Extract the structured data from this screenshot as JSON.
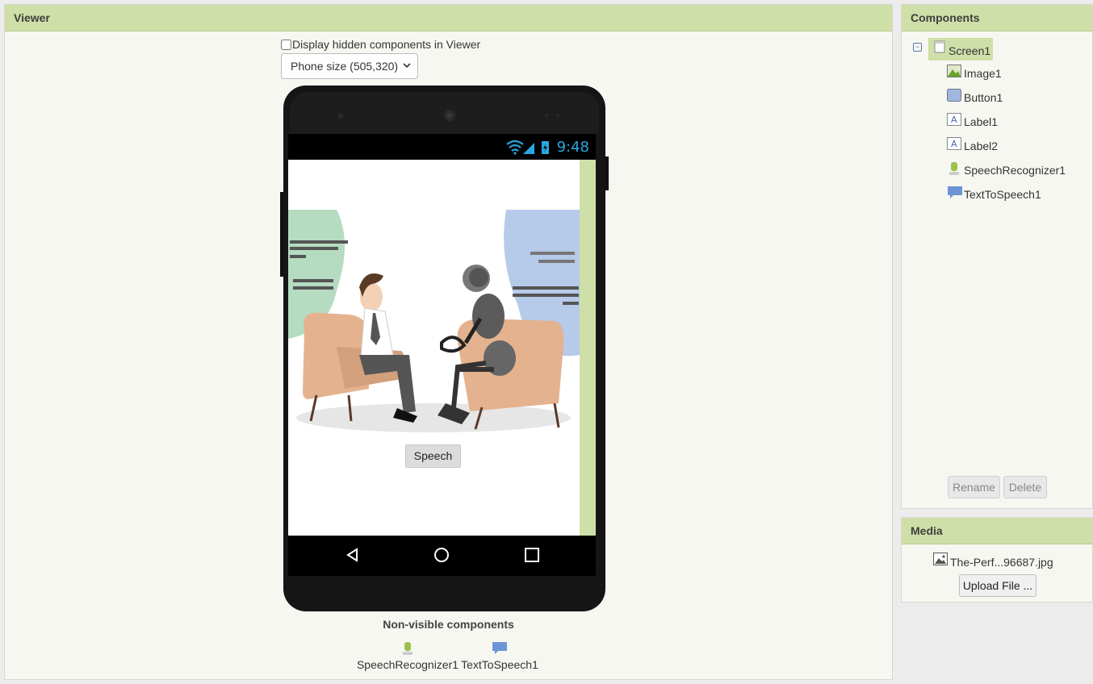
{
  "viewer": {
    "title": "Viewer",
    "hidden_label": "Display hidden components in Viewer",
    "size_select": "Phone size (505,320)",
    "phone": {
      "time": "9:48",
      "button_label": "Speech"
    },
    "nonvisible_title": "Non-visible components",
    "nonvisible": [
      {
        "label": "SpeechRecognizer1",
        "icon": "microphone-icon"
      },
      {
        "label": "TextToSpeech1",
        "icon": "speech-bubble-icon"
      }
    ]
  },
  "components": {
    "title": "Components",
    "root": "Screen1",
    "items": [
      {
        "label": "Image1",
        "icon": "image-icon"
      },
      {
        "label": "Button1",
        "icon": "button-icon"
      },
      {
        "label": "Label1",
        "icon": "label-icon"
      },
      {
        "label": "Label2",
        "icon": "label-icon"
      },
      {
        "label": "SpeechRecognizer1",
        "icon": "microphone-icon"
      },
      {
        "label": "TextToSpeech1",
        "icon": "speech-bubble-icon"
      }
    ],
    "rename_label": "Rename",
    "delete_label": "Delete"
  },
  "media": {
    "title": "Media",
    "file": "The-Perf...96687.jpg",
    "upload_label": "Upload File ..."
  },
  "colors": {
    "header_green": "#cfdfa8",
    "panel_bg": "#f7f7f2",
    "status_blue": "#2aa7e0"
  }
}
